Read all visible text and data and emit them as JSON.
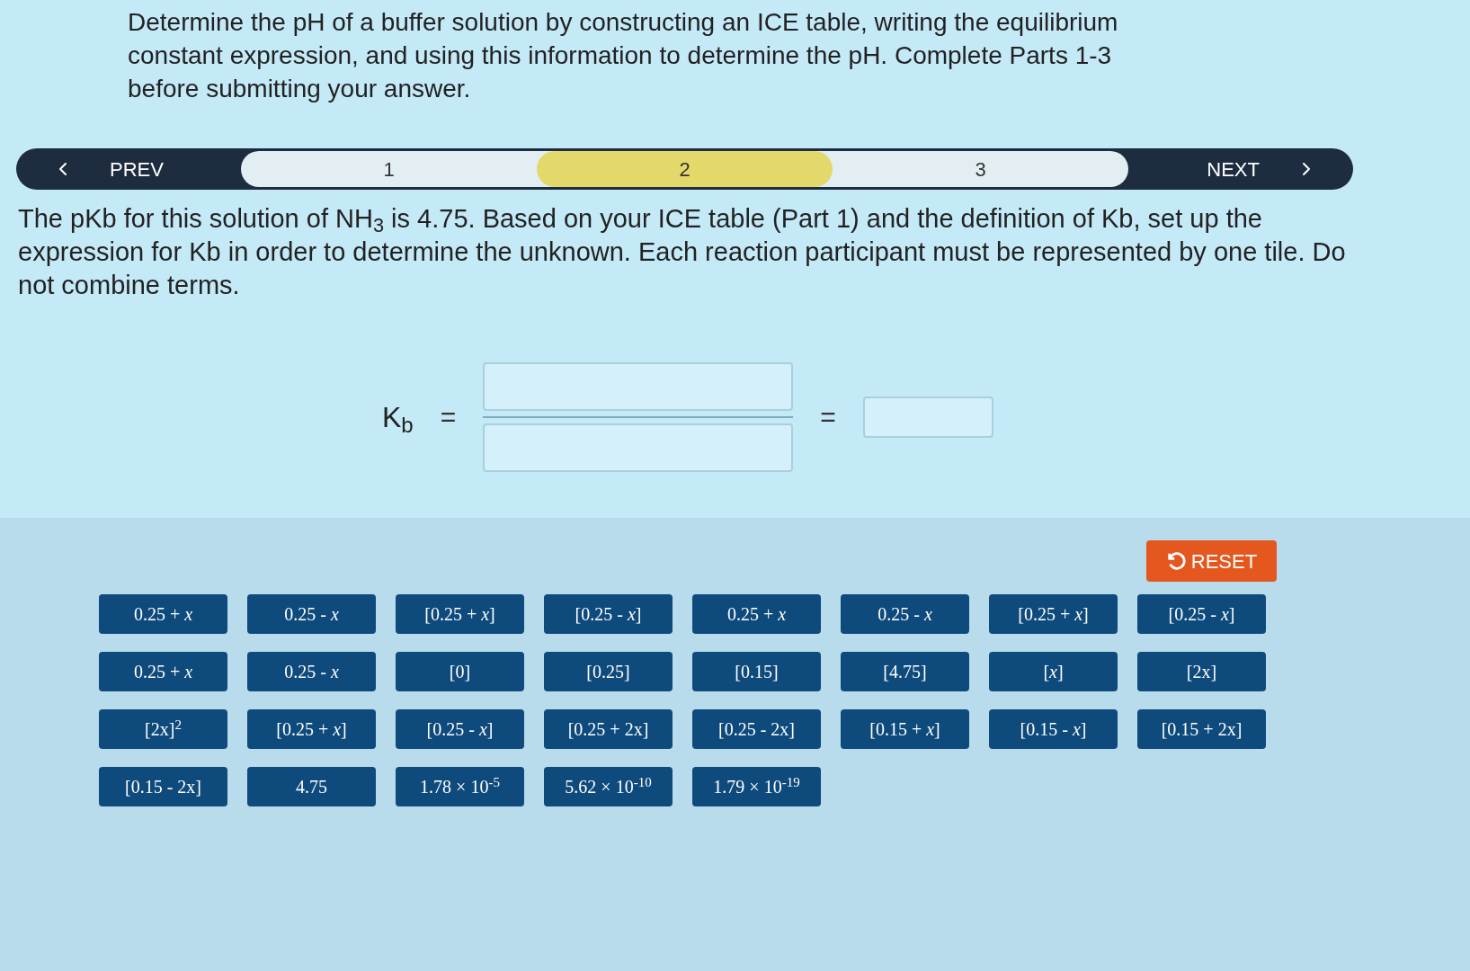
{
  "instructions": "Determine the pH of a buffer solution by constructing an ICE table, writing the equilibrium constant expression, and using this information to determine the pH. Complete Parts 1-3 before submitting your answer.",
  "nav": {
    "prev": "PREV",
    "next": "NEXT",
    "steps": [
      {
        "label": "1",
        "selected": false
      },
      {
        "label": "2",
        "selected": true
      },
      {
        "label": "3",
        "selected": false
      }
    ]
  },
  "question": "The pKb for this solution of NH$_{3}$ is 4.75. Based on your ICE table (Part 1) and the definition of Kb, set up the expression for Kb in order to determine the unknown. Each reaction participant must be represented by one tile. Do not combine terms.",
  "equation": {
    "lhs": "K$_{b}$",
    "equals": [
      "=",
      "="
    ]
  },
  "reset": "RESET",
  "tiles": [
    "0.25 + *x*",
    "0.25 - *x*",
    "[0.25 + *x*]",
    "[0.25 - *x*]",
    "0.25 + *x*",
    "0.25 - *x*",
    "[0.25 + *x*]",
    "[0.25 - *x*]",
    "0.25 + *x*",
    "0.25 - *x*",
    "[0]",
    "[0.25]",
    "[0.15]",
    "[4.75]",
    "[*x*]",
    "[2x]",
    "[2x]$^{2}$",
    "[0.25 + *x*]",
    "[0.25 - *x*]",
    "[0.25 + 2x]",
    "[0.25 - 2x]",
    "[0.15 + *x*]",
    "[0.15 - *x*]",
    "[0.15 + 2x]",
    "[0.15 - 2x]",
    "4.75",
    "1.78 × 10$^{-5}$",
    "5.62 × 10$^{-10}$",
    "1.79 × 10$^{-19}$"
  ]
}
